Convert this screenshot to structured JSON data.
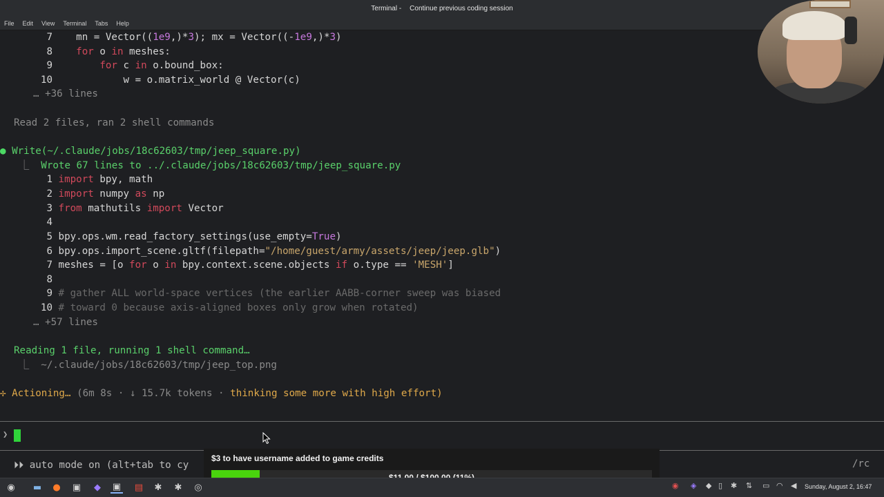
{
  "window": {
    "title": "Terminal -",
    "subtitle": "Continue previous coding session"
  },
  "menu": [
    "File",
    "Edit",
    "View",
    "Terminal",
    "Tabs",
    "Help"
  ],
  "terminal": {
    "block1": [
      {
        "n": "7",
        "code": "mn = Vector((1e9,)*3); mx = Vector((-1e9,)*3)"
      },
      {
        "n": "8",
        "code": "for o in meshes:"
      },
      {
        "n": "9",
        "code": "for c in o.bound_box:"
      },
      {
        "n": "10",
        "code": "w = o.matrix_world @ Vector(c)"
      }
    ],
    "more1": "… +36 lines",
    "read_summary": "Read 2 files, ran 2 shell commands",
    "write_header": "Write(~/.claude/jobs/18c62603/tmp/jeep_square.py)",
    "wrote_line": "Wrote 67 lines to ../.claude/jobs/18c62603/tmp/jeep_square.py",
    "block2": [
      {
        "n": "1",
        "code": "import bpy, math"
      },
      {
        "n": "2",
        "code": "import numpy as np"
      },
      {
        "n": "3",
        "code": "from mathutils import Vector"
      },
      {
        "n": "4",
        "code": ""
      },
      {
        "n": "5",
        "code": "bpy.ops.wm.read_factory_settings(use_empty=True)"
      },
      {
        "n": "6",
        "code": "bpy.ops.import_scene.gltf(filepath=\"/home/guest/army/assets/jeep/jeep.glb\")"
      },
      {
        "n": "7",
        "code": "meshes = [o for o in bpy.context.scene.objects if o.type == 'MESH']"
      },
      {
        "n": "8",
        "code": ""
      },
      {
        "n": "9",
        "code": "# gather ALL world-space vertices (the earlier AABB-corner sweep was biased"
      },
      {
        "n": "10",
        "code": "# toward 0 because axis-aligned boxes only grow when rotated)"
      }
    ],
    "more2": "… +57 lines",
    "reading_status": "Reading 1 file, running 1 shell command…",
    "reading_path": "~/.claude/jobs/18c62603/tmp/jeep_top.png",
    "actioning": "Actioning…",
    "actioning_meta": "(6m 8s · ↓ 15.7k tokens ·",
    "actioning_effort": "thinking some more with high effort)",
    "auto_mode": "⏵⏵ auto mode on (alt+tab to cy",
    "rc": "/rc"
  },
  "donation": {
    "label": "$3 to have username added to game credits",
    "progress_text": "$11.00 / $100.00 (11%)",
    "progress_fraction": 0.11,
    "fill_color": "#49d30d"
  },
  "clock": "Sunday, August  2, 16:47",
  "taskbar_icons": [
    "menu-icon",
    "files-icon",
    "firefox-icon",
    "terminal-icon",
    "blender-icon",
    "terminal-active-icon",
    "pdf-icon",
    "settings-icon",
    "settings2-icon",
    "steam-icon"
  ]
}
